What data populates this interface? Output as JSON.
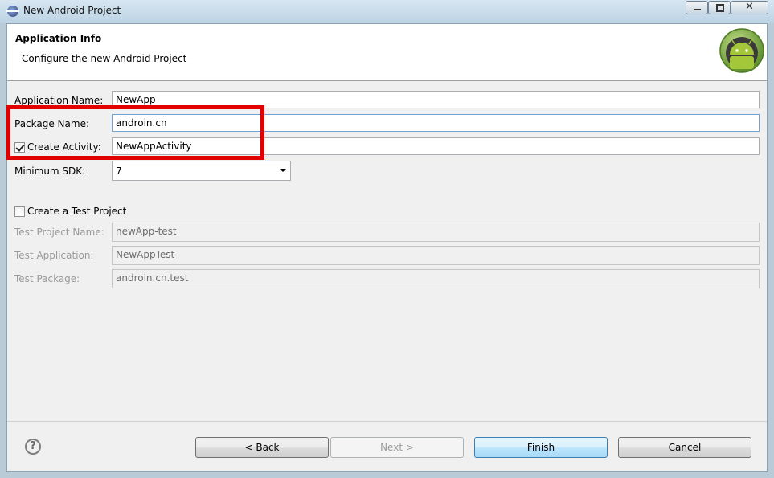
{
  "window": {
    "title": "New Android Project",
    "controls": {
      "close": "✕"
    }
  },
  "header": {
    "title": "Application Info",
    "subtitle": "Configure the new Android Project",
    "logo_icon": "android-logo-icon"
  },
  "form": {
    "application_name": {
      "label": "Application Name:",
      "value": "NewApp"
    },
    "package_name": {
      "label": "Package Name:",
      "value": "androin.cn"
    },
    "create_activity": {
      "label": "Create Activity:",
      "checked": true,
      "value": "NewAppActivity"
    },
    "minimum_sdk": {
      "label": "Minimum SDK:",
      "value": "7"
    }
  },
  "test_project": {
    "checkbox_label": "Create a Test Project",
    "checked": false,
    "project_name": {
      "label": "Test Project Name:",
      "value": "newApp-test"
    },
    "application": {
      "label": "Test Application:",
      "value": "NewAppTest"
    },
    "package": {
      "label": "Test Package:",
      "value": "androin.cn.test"
    }
  },
  "footer": {
    "help": "?",
    "back": "< Back",
    "next": "Next >",
    "finish": "Finish",
    "cancel": "Cancel"
  },
  "colors": {
    "highlight": "#e00000",
    "android_green": "#7cb342"
  }
}
